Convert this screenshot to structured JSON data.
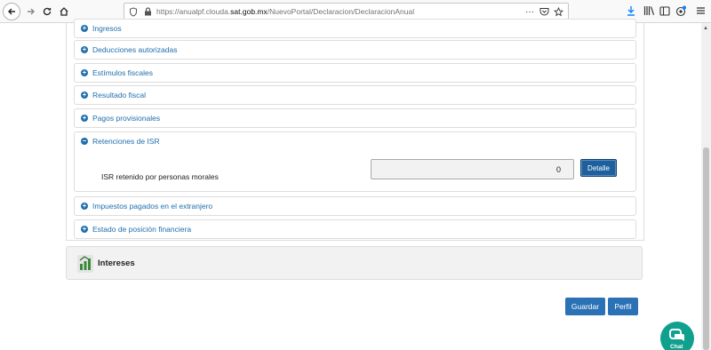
{
  "browser": {
    "url_prefix": "https://anualpf.clouda.",
    "url_domain": "sat.gob.mx",
    "url_path": "/NuevoPortal/Declaracion/DeclaracionAnual",
    "more_label": "···"
  },
  "sections": [
    {
      "label": "Ingresos",
      "icon": "plus"
    },
    {
      "label": "Deducciones autorizadas",
      "icon": "plus"
    },
    {
      "label": "Estímulos fiscales",
      "icon": "plus"
    },
    {
      "label": "Resultado fiscal",
      "icon": "plus"
    },
    {
      "label": "Pagos provisionales",
      "icon": "plus"
    },
    {
      "label": "Retenciones de ISR",
      "icon": "minus"
    },
    {
      "label": "Impuestos pagados en el extranjero",
      "icon": "plus"
    },
    {
      "label": "Estado de posición financiera",
      "icon": "plus"
    }
  ],
  "retenciones": {
    "field_label": "ISR retenido por personas morales",
    "field_value": "0",
    "detail_button": "Detalle"
  },
  "intereses": {
    "label": "Intereses"
  },
  "actions": {
    "save": "Guardar",
    "profile": "Perfil"
  },
  "chat": {
    "label": "Chat"
  },
  "colors": {
    "link": "#1f6fad",
    "button": "#2a72b5",
    "chat": "#0fa18e"
  }
}
